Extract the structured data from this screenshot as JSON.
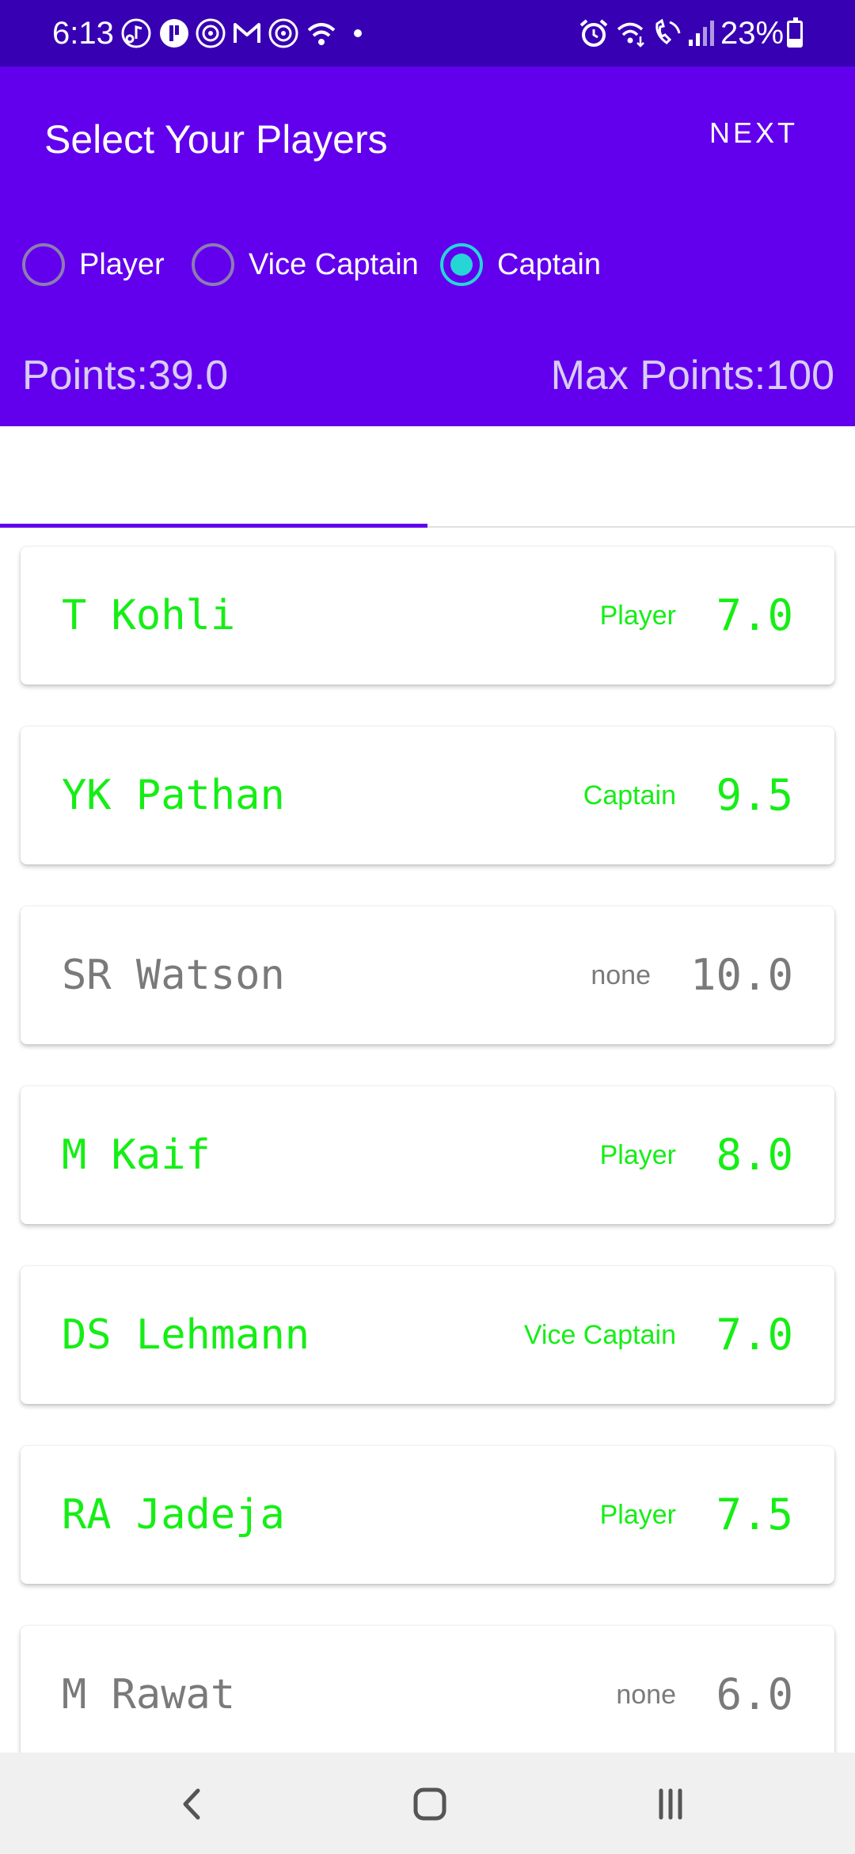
{
  "status_bar": {
    "time": "6:13",
    "battery": "23%",
    "icons": [
      "music-notification-icon",
      "app-notification-icon",
      "target-notification-icon",
      "gmail-icon",
      "target-notification-icon",
      "wifi-icon",
      "dot-icon",
      "alarm-icon",
      "wifi-calling-icon",
      "call-signal-icon",
      "battery-icon"
    ]
  },
  "app_bar": {
    "title": "Select Your Players",
    "next_label": "NEXT",
    "radio_options": [
      {
        "label": "Player",
        "checked": false
      },
      {
        "label": "Vice Captain",
        "checked": false
      },
      {
        "label": "Captain",
        "checked": true
      }
    ],
    "points_label": "Points:39.0",
    "max_points_label": "Max Points:100"
  },
  "players": [
    {
      "name": "T Kohli",
      "role": "Player",
      "points": "7.0",
      "selected": true
    },
    {
      "name": "YK Pathan",
      "role": "Captain",
      "points": "9.5",
      "selected": true
    },
    {
      "name": "SR Watson",
      "role": "none",
      "points": "10.0",
      "selected": false
    },
    {
      "name": "M Kaif",
      "role": "Player",
      "points": "8.0",
      "selected": true
    },
    {
      "name": "DS Lehmann",
      "role": "Vice Captain",
      "points": "7.0",
      "selected": true
    },
    {
      "name": "RA Jadeja",
      "role": "Player",
      "points": "7.5",
      "selected": true
    },
    {
      "name": "M Rawat",
      "role": "none",
      "points": "6.0",
      "selected": false
    }
  ],
  "colors": {
    "app_bar": "#6200ee",
    "status_bar": "#3700b3",
    "selected_text": "#15ee15",
    "unselected_text": "#7a7a7a",
    "radio_checked": "#26d6d6"
  },
  "nav_bar": {
    "icons": [
      "back-icon",
      "home-icon",
      "recents-icon"
    ]
  }
}
